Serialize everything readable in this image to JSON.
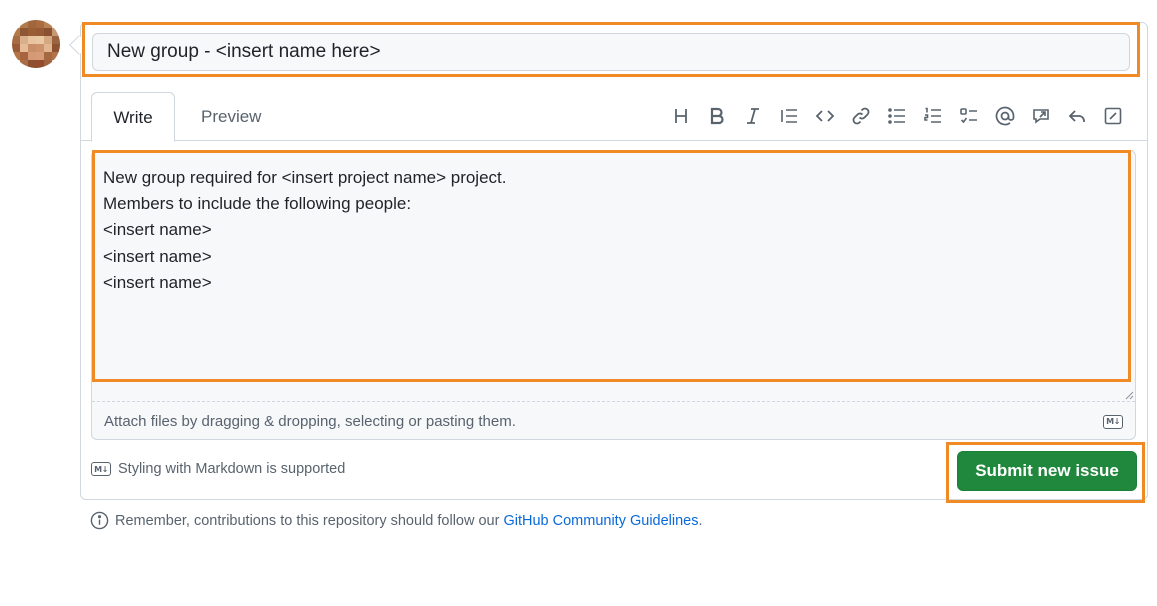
{
  "colors": {
    "highlight": "#f08a24",
    "submit_bg": "#1f883d",
    "link": "#0969da",
    "muted": "#59636e"
  },
  "issue": {
    "title_value": "New group - <insert name here>",
    "tabs": [
      {
        "label": "Write",
        "active": true
      },
      {
        "label": "Preview",
        "active": false
      }
    ],
    "toolbar": [
      {
        "name": "heading-icon"
      },
      {
        "name": "bold-icon"
      },
      {
        "name": "italic-icon"
      },
      {
        "name": "quote-icon"
      },
      {
        "name": "code-icon"
      },
      {
        "name": "link-icon"
      },
      {
        "name": "unordered-list-icon"
      },
      {
        "name": "ordered-list-icon"
      },
      {
        "name": "task-list-icon"
      },
      {
        "name": "mention-icon"
      },
      {
        "name": "reference-icon"
      },
      {
        "name": "saved-replies-icon"
      },
      {
        "name": "fullscreen-icon"
      }
    ],
    "body_value": "New group required for <insert project name> project.\nMembers to include the following people:\n<insert name>\n<insert name>\n<insert name>",
    "attach_text": "Attach files by dragging & dropping, selecting or pasting them.",
    "markdown_note": "Styling with Markdown is supported",
    "markdown_badge": "M↓",
    "submit_label": "Submit new issue"
  },
  "footer": {
    "text": "Remember, contributions to this repository should follow our",
    "link_label": "GitHub Community Guidelines",
    "trailing": "."
  }
}
